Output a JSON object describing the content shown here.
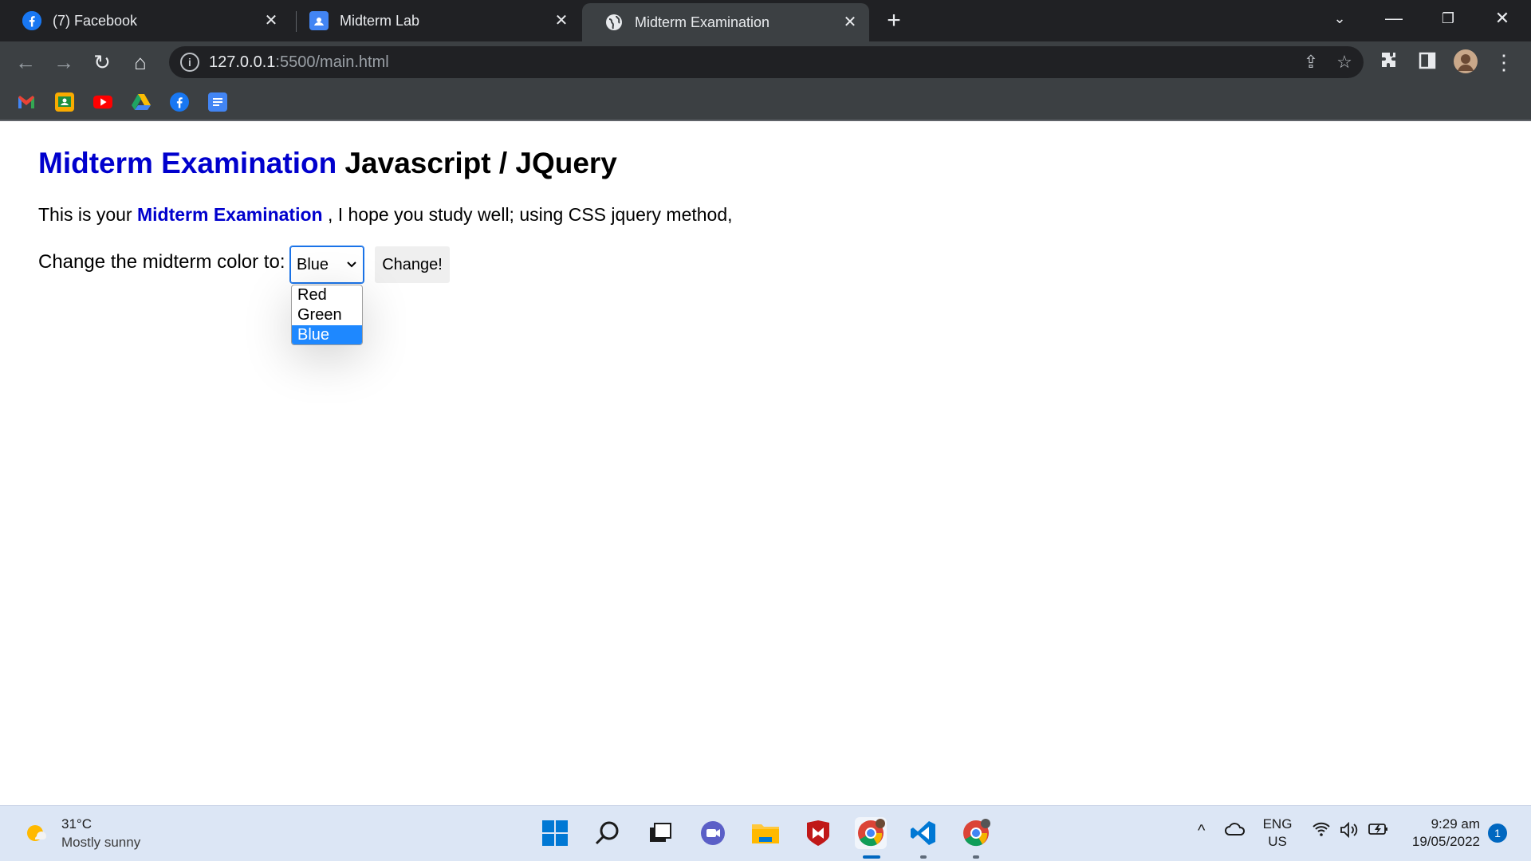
{
  "browser": {
    "tabs": [
      {
        "title": "(7) Facebook",
        "icon": "facebook-icon"
      },
      {
        "title": "Midterm Lab",
        "icon": "classroom-icon"
      },
      {
        "title": "Midterm Examination",
        "icon": "globe-icon",
        "active": true
      }
    ],
    "new_tab": "+",
    "address": {
      "host": "127.0.0.1",
      "path": ":5500/main.html"
    },
    "bookmarks": [
      "gmail-icon",
      "classroom-icon",
      "youtube-icon",
      "google-drive-icon",
      "facebook-icon",
      "google-docs-icon"
    ]
  },
  "page": {
    "heading": {
      "highlight": "Midterm Examination",
      "rest": "Javascript / JQuery"
    },
    "paragraph": {
      "before": "This is your",
      "highlight": "Midterm Examination",
      "after": ", I hope you study well; using CSS jquery method,"
    },
    "form": {
      "label": "Change the midterm color to:",
      "selected": "Blue",
      "options": [
        "Red",
        "Green",
        "Blue"
      ],
      "button": "Change!"
    },
    "colors": {
      "highlight": "#0000cd",
      "selected_option": "#1e88ff"
    }
  },
  "taskbar": {
    "weather": {
      "temp": "31°C",
      "desc": "Mostly sunny"
    },
    "apps": [
      "windows-start-icon",
      "search-icon",
      "task-view-icon",
      "teams-chat-icon",
      "file-explorer-icon",
      "mcafee-icon",
      "chrome-icon",
      "vscode-icon",
      "chrome-profile-icon"
    ],
    "lang": {
      "line1": "ENG",
      "line2": "US"
    },
    "time": "9:29 am",
    "date": "19/05/2022",
    "notifications": "1"
  }
}
